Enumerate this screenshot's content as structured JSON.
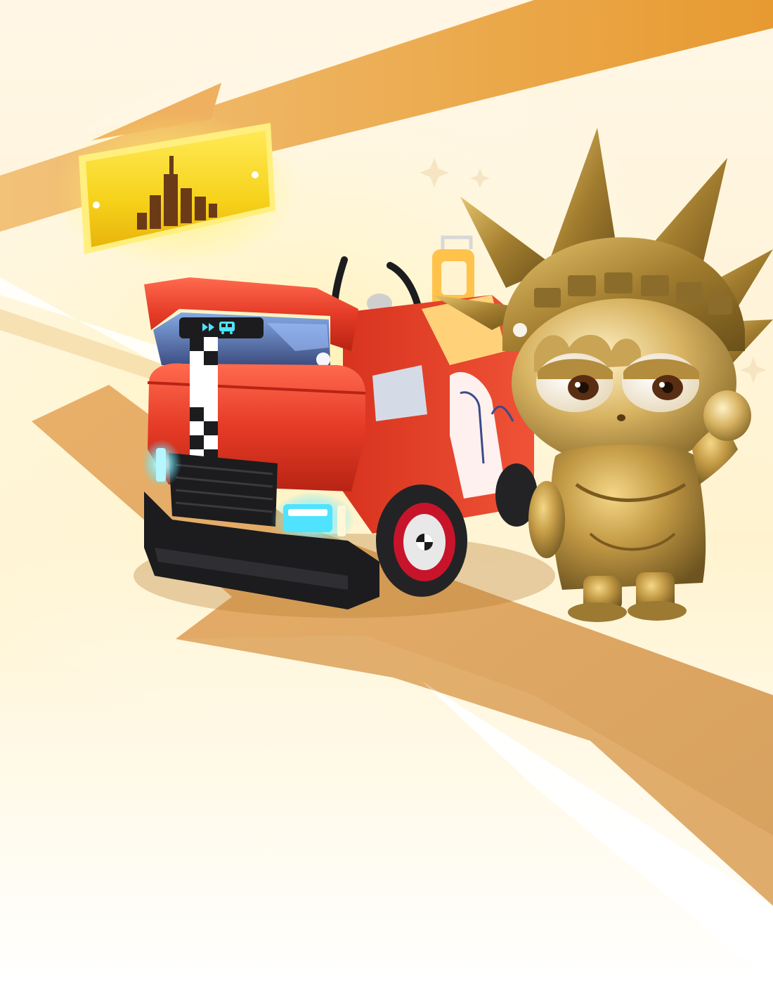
{
  "scene": {
    "type": "promo-art",
    "subjects": [
      "city-plaque-icon",
      "bus-kart",
      "liberty-statue-character"
    ]
  },
  "colors": {
    "stripe_orange": "#e39a3a",
    "stripe_light": "#f0b560",
    "road_tan": "#d9a45a",
    "plaque_yellow": "#f5d21f",
    "skyline_brown": "#6b3a17",
    "kart_red": "#e53b26",
    "kart_black": "#1c1c1e",
    "headlight_cyan": "#4fe3ff",
    "statue_gold": "#b08a3a"
  },
  "icons": [
    "skyline-icon",
    "sparkle-icon",
    "bus-icon",
    "fast-forward-icon"
  ]
}
